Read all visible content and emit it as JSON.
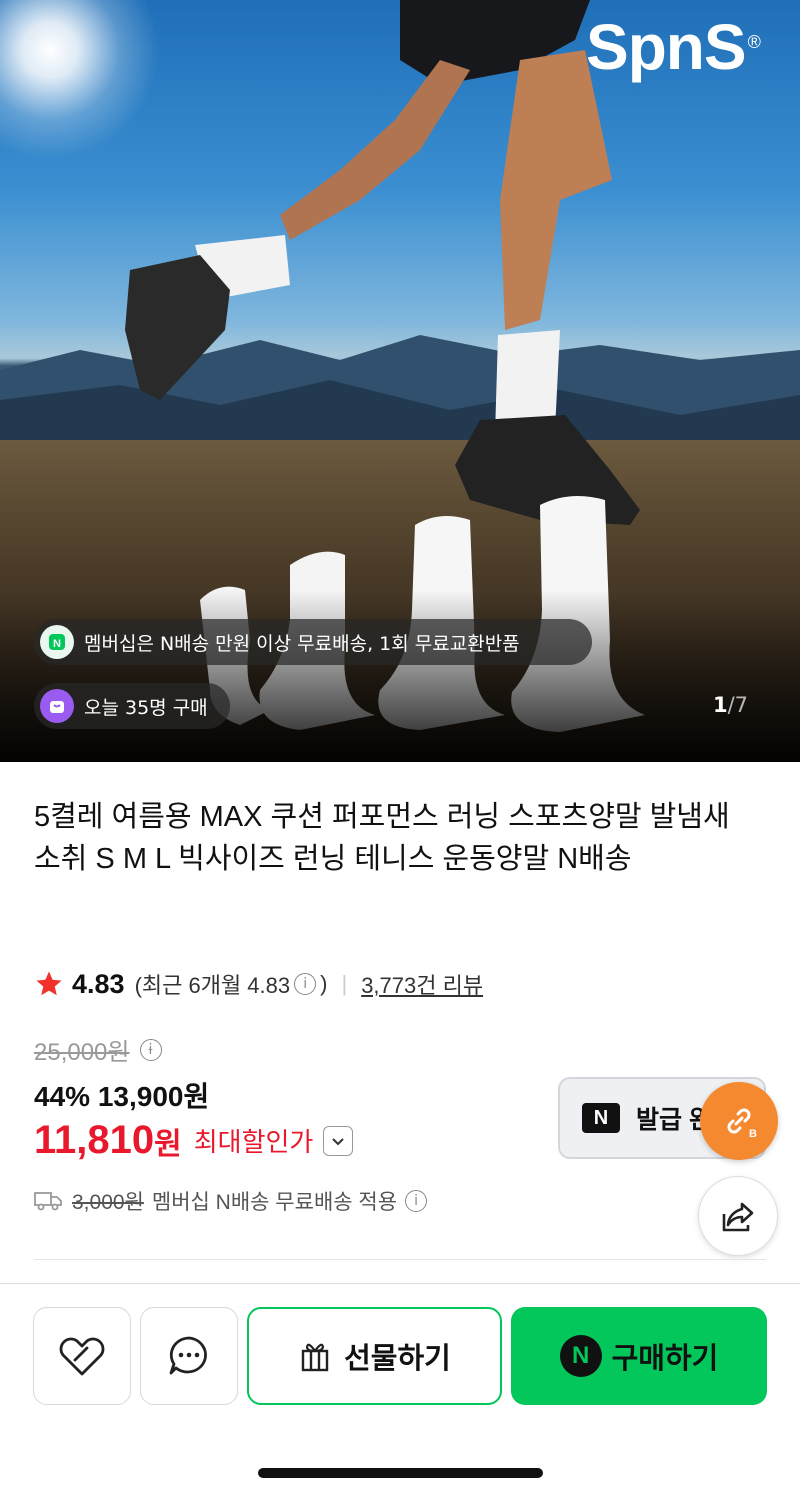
{
  "hero": {
    "logo": "SpnS",
    "logo_mark": "®",
    "membership_banner": "멤버십은 N배송 만원 이상 무료배송, 1회 무료교환반품",
    "purchase_today": "오늘 35명 구매",
    "image_index": "1",
    "image_total": "/7"
  },
  "product": {
    "title": "5켤레 여름용 MAX 쿠션 퍼포먼스 러닝 스포츠양말 발냄새소취 S M L 빅사이즈 런닝 테니스 운동양말 N배송",
    "rating": "4.83",
    "rating_recent": "(최근 6개월 4.83",
    "rating_recent_close": ")",
    "review_count": "3,773건 리뷰",
    "original_price": "25,000원",
    "discount_price": "44% 13,900원",
    "max_discount_amount": "11,810",
    "max_discount_won": "원",
    "max_discount_label": "최대할인가",
    "coupon_label": "발급 완",
    "shipping_original": "3,000원",
    "shipping_note": "멤버십 N배송 무료배송 적용"
  },
  "actions": {
    "gift_label": "선물하기",
    "buy_label": "구매하기"
  },
  "colors": {
    "accent_green": "#03c75a",
    "sale_red": "#e8192c",
    "fab_orange": "#f4892f"
  }
}
